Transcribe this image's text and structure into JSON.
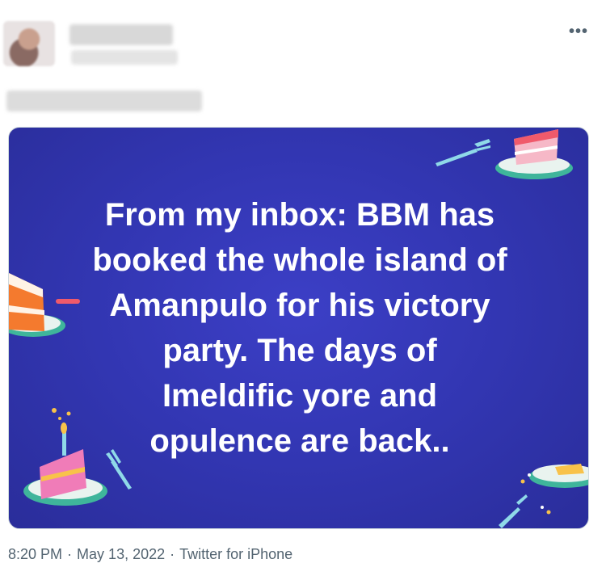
{
  "header": {
    "more_label": "•••"
  },
  "media": {
    "quote_lines": [
      "From my inbox: BBM has",
      "booked the whole island of",
      "Amanpulo for his victory",
      "party.  The days of",
      "Imeldific yore and",
      "opulence are back.."
    ]
  },
  "footer": {
    "time": "8:20 PM",
    "date": "May 13, 2022",
    "source": "Twitter for iPhone",
    "separator": "·"
  },
  "colors": {
    "background_blue": "#3236b2",
    "text_gray": "#536471"
  }
}
